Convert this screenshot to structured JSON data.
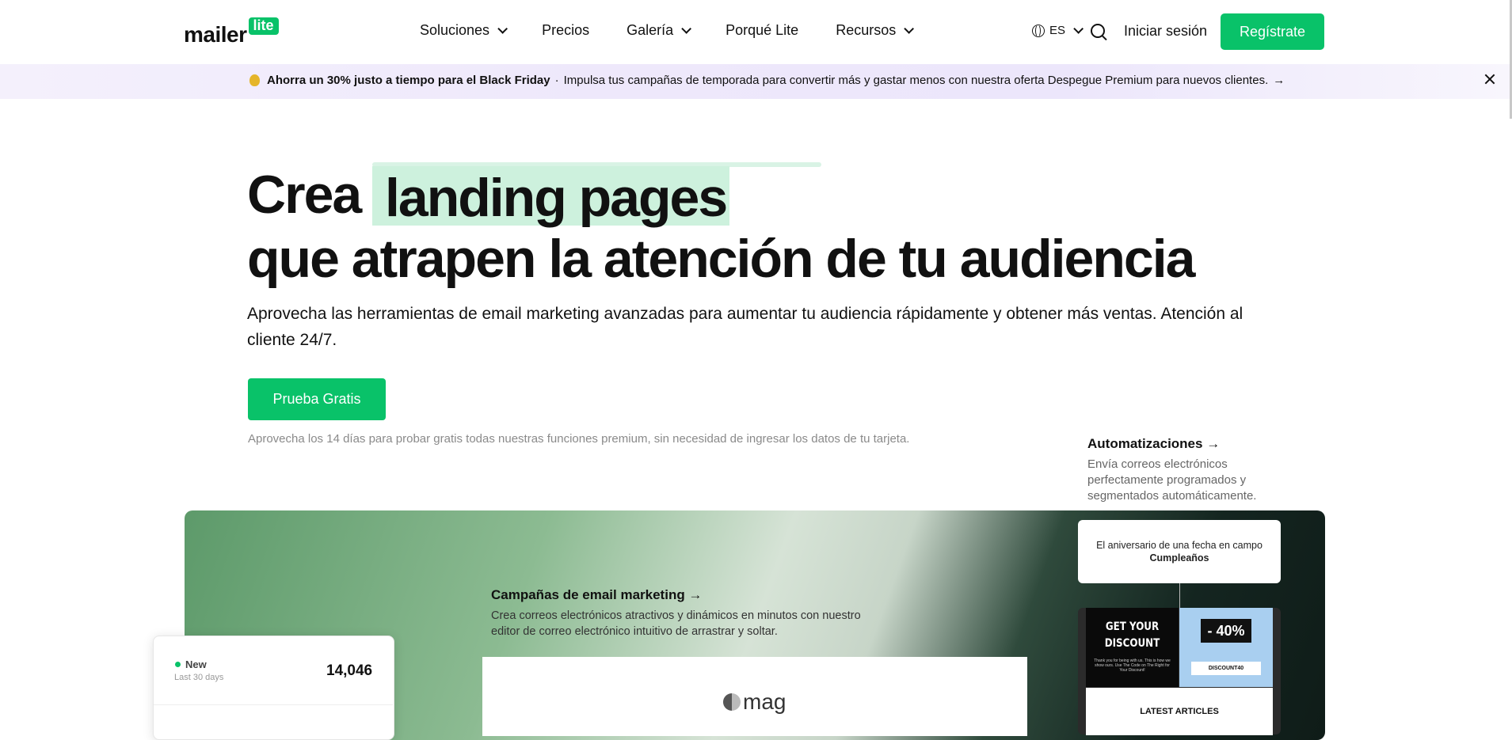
{
  "header": {
    "logo_text": "mailer",
    "logo_badge": "lite",
    "nav": [
      {
        "label": "Soluciones",
        "dropdown": true
      },
      {
        "label": "Precios",
        "dropdown": false
      },
      {
        "label": "Galería",
        "dropdown": true
      },
      {
        "label": "Porqué Lite",
        "dropdown": false
      },
      {
        "label": "Recursos",
        "dropdown": true
      }
    ],
    "language": "ES",
    "login_label": "Iniciar sesión",
    "signup_label": "Regístrate"
  },
  "banner": {
    "bold_text": "Ahorra un 30% justo a tiempo para el Black Friday",
    "separator": "·",
    "text": "Impulsa tus campañas de temporada para convertir más y gastar menos con nuestra oferta Despegue Premium para nuevos clientes.",
    "arrow": "→"
  },
  "hero": {
    "title_start": "Crea",
    "title_highlight": "landing pages",
    "title_rest": "que atrapen la atención de tu audiencia",
    "subtitle": "Aprovecha las herramientas de email marketing avanzadas para aumentar tu audiencia rápidamente y obtener más ventas. Atención al cliente 24/7.",
    "cta_label": "Prueba Gratis",
    "note": "Aprovecha los 14 días para probar gratis todas nuestras funciones premium, sin necesidad de ingresar los datos de tu tarjeta."
  },
  "automations": {
    "title": "Automatizaciones →",
    "description": "Envía correos electrónicos perfectamente programados y segmentados automáticamente."
  },
  "campaigns": {
    "title": "Campañas de email marketing →",
    "description": "Crea correos electrónicos atractivos y dinámicos en minutos con nuestro editor de correo electrónico intuitivo de arrastrar y soltar.",
    "email_brand": "mag"
  },
  "stats": {
    "label": "New",
    "sublabel": "Last 30 days",
    "value": "14,046"
  },
  "birthday_card": {
    "text": "El aniversario de una fecha en campo",
    "bold": "Cumpleaños"
  },
  "email_preview": {
    "headline": "GET YOUR DISCOUNT",
    "small_text": "Thank you for being with us. This is how we show ours. Use The Code on The Right for Your Discount!",
    "percent": "- 40%",
    "code": "DISCOUNT40",
    "latest": "LATEST ARTICLES"
  },
  "colors": {
    "brand_green": "#09c269",
    "highlight": "#cdf1dd",
    "banner_bg": "#eee8fb"
  }
}
